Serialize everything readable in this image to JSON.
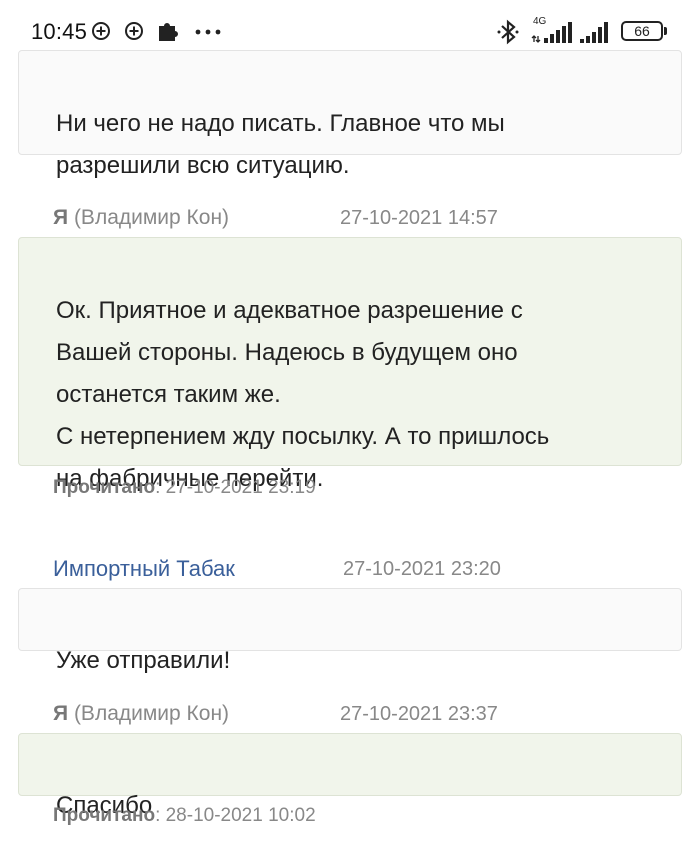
{
  "status_bar": {
    "time": "10:45",
    "network": "4G",
    "battery": "66",
    "icons": [
      "plus-circle-icon",
      "plus-circle-icon",
      "puzzle-icon",
      "more-dots-icon",
      "bluetooth-icon",
      "signal-icon",
      "signal-icon",
      "battery-icon"
    ]
  },
  "messages": [
    {
      "direction": "in",
      "text": "Ни чего не надо писать. Главное что мы\nразрешили всю ситуацию."
    },
    {
      "direction": "out",
      "author_me": "Я",
      "author_name": "(Владимир Кон)",
      "date": "27-10-2021 14:57",
      "text": "Ок. Приятное и адекватное разрешение с\nВашей стороны. Надеюсь в будущем оно\nостанется таким же.\nС нетерпением жду посылку. А то пришлось\nна фабричные перейти.",
      "read_label": "Прочитано",
      "read_time": ": 27-10-2021 23:19"
    },
    {
      "direction": "in",
      "author": "Импортный Табак",
      "date": "27-10-2021 23:20",
      "text": "Уже отправили!"
    },
    {
      "direction": "out",
      "author_me": "Я",
      "author_name": "(Владимир Кон)",
      "date": "27-10-2021 23:37",
      "text": "Спасибо",
      "read_label": "Прочитано",
      "read_time": ": 28-10-2021 10:02"
    }
  ]
}
